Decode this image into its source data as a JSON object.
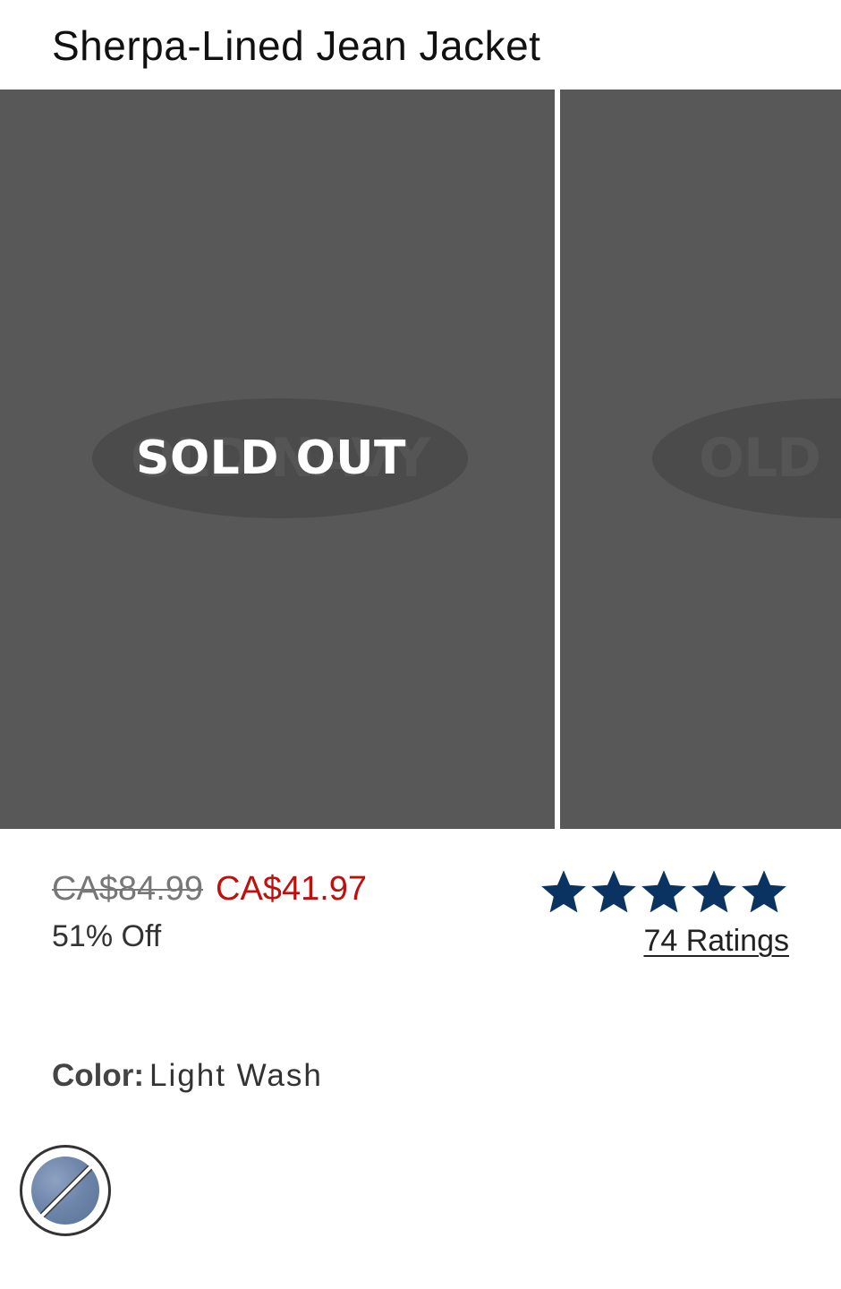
{
  "product": {
    "title": "Sherpa-Lined Jean Jacket"
  },
  "gallery": {
    "slides": [
      {
        "logo_text": "OLD NAVY",
        "status": "SOLD OUT"
      },
      {
        "logo_text": "OLD NAVY"
      }
    ]
  },
  "pricing": {
    "original_price": "CA$84.99",
    "sale_price": "CA$41.97",
    "discount": "51% Off",
    "sale_color": "#c00f0c"
  },
  "rating": {
    "stars": 5,
    "star_color": "#0a3362",
    "count_label": "74 Ratings"
  },
  "color": {
    "label": "Color:",
    "value": "Light Wash",
    "swatches": [
      {
        "name": "Light Wash",
        "selected": true,
        "available": false
      }
    ]
  }
}
